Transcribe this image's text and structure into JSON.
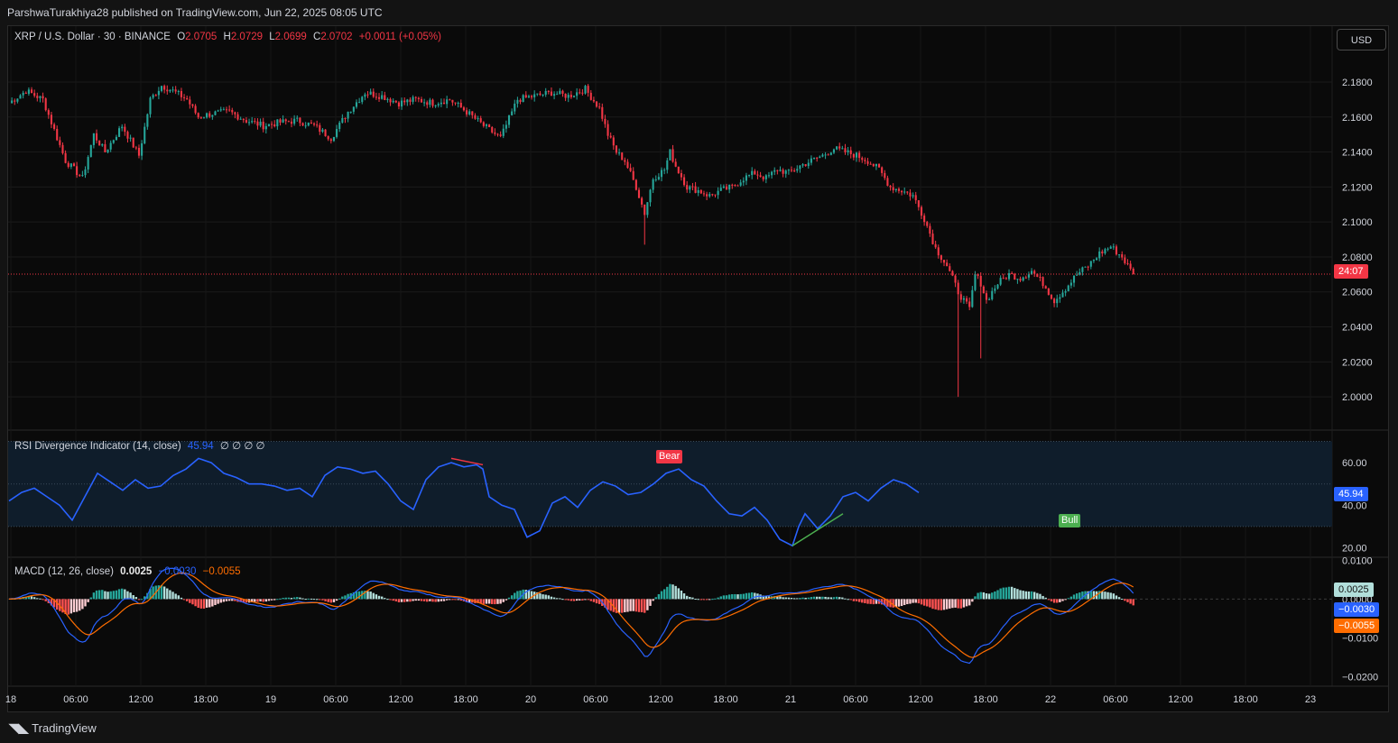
{
  "header": {
    "publisher_line": "ParshwaTurakhiya28 published on TradingView.com, Jun 22, 2025 08:05 UTC"
  },
  "main_legend": {
    "symbol": "XRP / U.S. Dollar · 30 · BINANCE",
    "o_label": "O",
    "o_value": "2.0705",
    "h_label": "H",
    "h_value": "2.0729",
    "l_label": "L",
    "l_value": "2.0699",
    "c_label": "C",
    "c_value": "2.0702",
    "change": "+0.0011 (+0.05%)"
  },
  "currency_button": "USD",
  "countdown_label": "24:07",
  "rsi_legend": {
    "name": "RSI Divergence Indicator (14, close)",
    "value": "45.94",
    "extras": "∅ ∅ ∅ ∅"
  },
  "rsi_value_label": "45.94",
  "bear_label": "Bear",
  "bull_label": "Bull",
  "macd_legend": {
    "name": "MACD (12, 26, close)",
    "hist": "0.0025",
    "macd": "−0.0030",
    "signal": "−0.0055"
  },
  "macd_labels": {
    "hist": "0.0025",
    "macd": "−0.0030",
    "signal": "−0.0055"
  },
  "footer": {
    "logo_text": "TradingView"
  },
  "colors": {
    "up": "#26a69a",
    "down": "#f23645",
    "rsi_line": "#2962ff",
    "macd_line": "#2962ff",
    "signal_line": "#ff6d00",
    "bg": "#0a0a0a"
  },
  "chart_data": [
    {
      "type": "candlestick",
      "title": "XRP / U.S. Dollar · 30 · BINANCE",
      "y_ticks": [
        "2.1800",
        "2.1600",
        "2.1400",
        "2.1200",
        "2.1000",
        "2.0800",
        "2.0600",
        "2.0400",
        "2.0200",
        "2.0000"
      ],
      "ylim": [
        1.9815,
        2.2037
      ],
      "x_ticks": [
        "18",
        "06:00",
        "12:00",
        "18:00",
        "19",
        "06:00",
        "12:00",
        "18:00",
        "20",
        "06:00",
        "12:00",
        "18:00",
        "21",
        "06:00",
        "12:00",
        "18:00",
        "22",
        "06:00",
        "12:00",
        "18:00",
        "23"
      ],
      "last_price": 2.0702,
      "close_path": [
        [
          0,
          2.168
        ],
        [
          6,
          2.175
        ],
        [
          12,
          2.17
        ],
        [
          20,
          2.135
        ],
        [
          26,
          2.125
        ],
        [
          30,
          2.15
        ],
        [
          34,
          2.14
        ],
        [
          40,
          2.155
        ],
        [
          46,
          2.138
        ],
        [
          50,
          2.17
        ],
        [
          54,
          2.178
        ],
        [
          58,
          2.175
        ],
        [
          63,
          2.17
        ],
        [
          67,
          2.16
        ],
        [
          72,
          2.162
        ],
        [
          78,
          2.163
        ],
        [
          84,
          2.158
        ],
        [
          90,
          2.155
        ],
        [
          96,
          2.157
        ],
        [
          102,
          2.158
        ],
        [
          108,
          2.155
        ],
        [
          114,
          2.148
        ],
        [
          120,
          2.163
        ],
        [
          126,
          2.174
        ],
        [
          132,
          2.172
        ],
        [
          138,
          2.168
        ],
        [
          144,
          2.17
        ],
        [
          150,
          2.168
        ],
        [
          156,
          2.17
        ],
        [
          162,
          2.163
        ],
        [
          168,
          2.155
        ],
        [
          174,
          2.148
        ],
        [
          180,
          2.17
        ],
        [
          186,
          2.172
        ],
        [
          192,
          2.174
        ],
        [
          198,
          2.172
        ],
        [
          204,
          2.176
        ],
        [
          209,
          2.165
        ],
        [
          212,
          2.15
        ],
        [
          215,
          2.14
        ],
        [
          218,
          2.135
        ],
        [
          222,
          2.12
        ],
        [
          225,
          2.105
        ],
        [
          228,
          2.125
        ],
        [
          232,
          2.13
        ],
        [
          234,
          2.14
        ],
        [
          236,
          2.132
        ],
        [
          240,
          2.12
        ],
        [
          244,
          2.118
        ],
        [
          248,
          2.115
        ],
        [
          252,
          2.118
        ],
        [
          256,
          2.12
        ],
        [
          260,
          2.125
        ],
        [
          264,
          2.128
        ],
        [
          268,
          2.125
        ],
        [
          272,
          2.13
        ],
        [
          276,
          2.128
        ],
        [
          280,
          2.132
        ],
        [
          284,
          2.135
        ],
        [
          288,
          2.138
        ],
        [
          292,
          2.142
        ],
        [
          296,
          2.14
        ],
        [
          300,
          2.138
        ],
        [
          304,
          2.135
        ],
        [
          308,
          2.13
        ],
        [
          312,
          2.12
        ],
        [
          316,
          2.118
        ],
        [
          320,
          2.115
        ],
        [
          324,
          2.102
        ],
        [
          328,
          2.085
        ],
        [
          332,
          2.075
        ],
        [
          336,
          2.06
        ],
        [
          340,
          2.05
        ],
        [
          342,
          2.07
        ],
        [
          344,
          2.065
        ],
        [
          346,
          2.055
        ],
        [
          348,
          2.06
        ],
        [
          350,
          2.065
        ],
        [
          354,
          2.07
        ],
        [
          358,
          2.068
        ],
        [
          362,
          2.072
        ],
        [
          366,
          2.065
        ],
        [
          370,
          2.055
        ],
        [
          374,
          2.062
        ],
        [
          378,
          2.07
        ],
        [
          382,
          2.075
        ],
        [
          386,
          2.082
        ],
        [
          390,
          2.086
        ],
        [
          394,
          2.08
        ],
        [
          398,
          2.07
        ]
      ]
    },
    {
      "type": "line",
      "name": "RSI Divergence Indicator (14, close)",
      "y_ticks": [
        "60.00",
        "40.00",
        "20.00"
      ],
      "ylim": [
        16,
        74
      ],
      "current": 45.94,
      "path": [
        [
          0,
          42
        ],
        [
          4,
          46
        ],
        [
          8,
          48
        ],
        [
          12,
          44
        ],
        [
          16,
          40
        ],
        [
          20,
          33
        ],
        [
          24,
          44
        ],
        [
          28,
          55
        ],
        [
          32,
          51
        ],
        [
          36,
          47
        ],
        [
          40,
          52
        ],
        [
          44,
          48
        ],
        [
          48,
          49
        ],
        [
          52,
          54
        ],
        [
          56,
          57
        ],
        [
          60,
          62
        ],
        [
          64,
          60
        ],
        [
          68,
          55
        ],
        [
          72,
          53
        ],
        [
          76,
          50
        ],
        [
          80,
          50
        ],
        [
          84,
          49
        ],
        [
          88,
          47
        ],
        [
          92,
          48
        ],
        [
          96,
          44
        ],
        [
          100,
          54
        ],
        [
          104,
          58
        ],
        [
          108,
          57
        ],
        [
          112,
          55
        ],
        [
          116,
          56
        ],
        [
          120,
          50
        ],
        [
          124,
          42
        ],
        [
          128,
          38
        ],
        [
          132,
          52
        ],
        [
          136,
          58
        ],
        [
          140,
          60
        ],
        [
          144,
          58
        ],
        [
          148,
          59
        ],
        [
          150,
          57
        ],
        [
          152,
          44
        ],
        [
          156,
          40
        ],
        [
          160,
          38
        ],
        [
          164,
          25
        ],
        [
          168,
          28
        ],
        [
          172,
          41
        ],
        [
          176,
          44
        ],
        [
          180,
          39
        ],
        [
          184,
          47
        ],
        [
          188,
          51
        ],
        [
          192,
          49
        ],
        [
          196,
          45
        ],
        [
          200,
          46
        ],
        [
          204,
          50
        ],
        [
          208,
          55
        ],
        [
          212,
          57
        ],
        [
          216,
          52
        ],
        [
          220,
          49
        ],
        [
          224,
          42
        ],
        [
          228,
          36
        ],
        [
          232,
          35
        ],
        [
          236,
          39
        ],
        [
          240,
          33
        ],
        [
          244,
          24
        ],
        [
          248,
          21
        ],
        [
          250,
          30
        ],
        [
          252,
          36
        ],
        [
          256,
          29
        ],
        [
          260,
          35
        ],
        [
          264,
          44
        ],
        [
          268,
          46
        ],
        [
          272,
          42
        ],
        [
          276,
          48
        ],
        [
          280,
          52
        ],
        [
          284,
          50
        ],
        [
          288,
          45.94
        ]
      ]
    },
    {
      "type": "bar+line",
      "name": "MACD (12, 26, close)",
      "y_ticks": [
        "0.0100",
        "0.0000",
        "−0.0100",
        "−0.0200"
      ],
      "ylim": [
        -0.0222,
        0.0103
      ],
      "histogram": 0.0025,
      "macd": -0.003,
      "signal": -0.0055
    }
  ]
}
